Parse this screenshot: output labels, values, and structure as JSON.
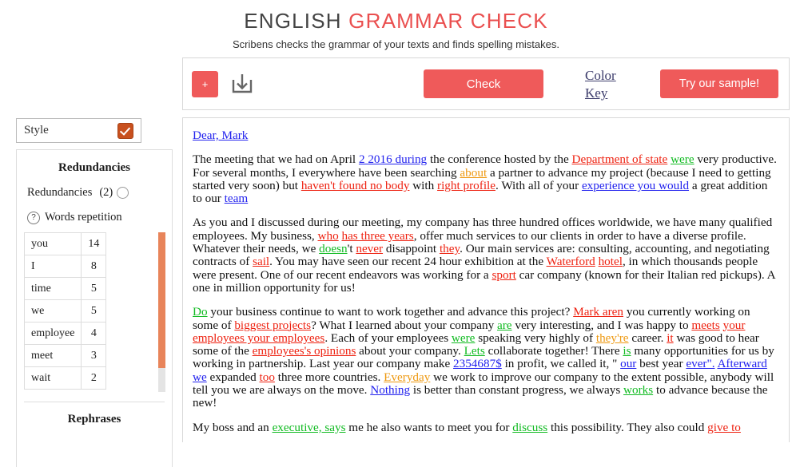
{
  "header": {
    "title_part1": "ENGLISH",
    "title_part2": "GRAMMAR CHECK",
    "subtitle": "Scribens checks the grammar of your texts and finds spelling mistakes.",
    "accent_red": "#ea4f4f",
    "title_gray": "#444444"
  },
  "toolbar": {
    "plus_label": "+",
    "download_icon": "download-icon",
    "check_label": "Check",
    "color_key_line1": "Color",
    "color_key_line2": "Key",
    "sample_label": "Try our sample!",
    "button_color": "#ef5a5a"
  },
  "sidebar": {
    "style_label": "Style",
    "style_checked": true,
    "checkbox_color": "#c8501e",
    "panel_title": "Redundancies",
    "redundancies_label": "Redundancies",
    "redundancies_count": "(2)",
    "help_glyph": "?",
    "words_repetition_label": "Words repetition",
    "repetition_rows": [
      {
        "word": "you",
        "count": "14"
      },
      {
        "word": "I",
        "count": "8"
      },
      {
        "word": "time",
        "count": "5"
      },
      {
        "word": "we",
        "count": "5"
      },
      {
        "word": "employee",
        "count": "4"
      },
      {
        "word": "meet",
        "count": "3"
      },
      {
        "word": "wait",
        "count": "2"
      }
    ],
    "scrollbar_thumb_color": "#e8845a",
    "rephrases_title": "Rephrases"
  },
  "editor": {
    "salutation": "Dear, Mark",
    "p1": [
      {
        "t": "The meeting that we had on April ",
        "c": ""
      },
      {
        "t": "2 2016 during",
        "c": "g-blue"
      },
      {
        "t": " the conference hosted by the ",
        "c": ""
      },
      {
        "t": "Department of state",
        "c": "g-red"
      },
      {
        "t": " ",
        "c": ""
      },
      {
        "t": "were",
        "c": "g-green"
      },
      {
        "t": " very productive. For several months, I everywhere have been searching ",
        "c": ""
      },
      {
        "t": "about",
        "c": "g-orange"
      },
      {
        "t": " a partner to advance my project (because I need to getting started very soon) but ",
        "c": ""
      },
      {
        "t": "haven't found no body",
        "c": "g-red"
      },
      {
        "t": " with ",
        "c": ""
      },
      {
        "t": "right profile",
        "c": "g-red"
      },
      {
        "t": ". With all of your ",
        "c": ""
      },
      {
        "t": "experience you would",
        "c": "g-blue"
      },
      {
        "t": " a great addition to our ",
        "c": ""
      },
      {
        "t": "team",
        "c": "g-blue"
      }
    ],
    "p2": [
      {
        "t": "As you and I discussed during our meeting, my company has three hundred offices worldwide, we have many qualified employees. My business, ",
        "c": ""
      },
      {
        "t": "who",
        "c": "g-red"
      },
      {
        "t": " ",
        "c": ""
      },
      {
        "t": "has three years",
        "c": "g-red"
      },
      {
        "t": ", offer much services to our clients in order to have a diverse profile. Whatever their needs, we ",
        "c": ""
      },
      {
        "t": "doesn",
        "c": "g-green"
      },
      {
        "t": "'t ",
        "c": ""
      },
      {
        "t": "never",
        "c": "g-red"
      },
      {
        "t": " disappoint ",
        "c": ""
      },
      {
        "t": "they",
        "c": "g-red"
      },
      {
        "t": ". Our main services are: consulting, accounting, and negotiating contracts of ",
        "c": ""
      },
      {
        "t": "sail",
        "c": "g-red"
      },
      {
        "t": ". You may have seen our recent 24 hour exhibition at the ",
        "c": ""
      },
      {
        "t": "Waterford",
        "c": "g-red"
      },
      {
        "t": " ",
        "c": ""
      },
      {
        "t": "hotel",
        "c": "g-red"
      },
      {
        "t": ", in which thousands people were present. One of our recent endeavors was working for a ",
        "c": ""
      },
      {
        "t": "sport",
        "c": "g-red"
      },
      {
        "t": " car company (known for their Italian red pickups). A one in million opportunity for us!",
        "c": ""
      }
    ],
    "p3": [
      {
        "t": "Do",
        "c": "g-green"
      },
      {
        "t": " your business continue to want to work together and advance this project? ",
        "c": ""
      },
      {
        "t": "Mark aren",
        "c": "g-red"
      },
      {
        "t": " you currently working on some of ",
        "c": ""
      },
      {
        "t": "biggest projects",
        "c": "g-red"
      },
      {
        "t": "? What I learned about your company ",
        "c": ""
      },
      {
        "t": "are",
        "c": "g-green"
      },
      {
        "t": " very interesting, and I was happy to ",
        "c": ""
      },
      {
        "t": "meets",
        "c": "g-red"
      },
      {
        "t": " ",
        "c": ""
      },
      {
        "t": "your employees your employees",
        "c": "g-red"
      },
      {
        "t": ". Each of your employees ",
        "c": ""
      },
      {
        "t": "were",
        "c": "g-green"
      },
      {
        "t": " speaking very highly of ",
        "c": ""
      },
      {
        "t": "they're",
        "c": "g-orange"
      },
      {
        "t": " career. ",
        "c": ""
      },
      {
        "t": "it",
        "c": "g-red"
      },
      {
        "t": " was good to hear some of the ",
        "c": ""
      },
      {
        "t": "employees's opinions",
        "c": "g-red"
      },
      {
        "t": " about your company. ",
        "c": ""
      },
      {
        "t": "Lets",
        "c": "g-green"
      },
      {
        "t": " collaborate together! There ",
        "c": ""
      },
      {
        "t": "is",
        "c": "g-green"
      },
      {
        "t": " many opportunities for us by working in partnership. Last year our company make ",
        "c": ""
      },
      {
        "t": "2354687$",
        "c": "g-blue"
      },
      {
        "t": " in profit, we called it, \" ",
        "c": ""
      },
      {
        "t": "our",
        "c": "g-blue"
      },
      {
        "t": " best year ",
        "c": ""
      },
      {
        "t": "ever\".",
        "c": "g-blue"
      },
      {
        "t": " ",
        "c": ""
      },
      {
        "t": "Afterward we",
        "c": "g-blue"
      },
      {
        "t": " expanded ",
        "c": ""
      },
      {
        "t": "too",
        "c": "g-red"
      },
      {
        "t": " three more countries. ",
        "c": ""
      },
      {
        "t": "Everyday",
        "c": "g-orange"
      },
      {
        "t": " we work to improve our company to the extent possible, anybody will tell you we are always on the move. ",
        "c": ""
      },
      {
        "t": "  Nothing",
        "c": "g-blue"
      },
      {
        "t": " is better than constant progress, we always ",
        "c": ""
      },
      {
        "t": "works",
        "c": "g-green"
      },
      {
        "t": " to advance because the new!",
        "c": ""
      }
    ],
    "p4": [
      {
        "t": "My boss and an ",
        "c": ""
      },
      {
        "t": "executive, says",
        "c": "g-green"
      },
      {
        "t": " me he also wants to meet you for ",
        "c": ""
      },
      {
        "t": "discuss",
        "c": "g-green"
      },
      {
        "t": " this possibility. They also could ",
        "c": ""
      },
      {
        "t": "give to",
        "c": "g-red"
      }
    ]
  }
}
